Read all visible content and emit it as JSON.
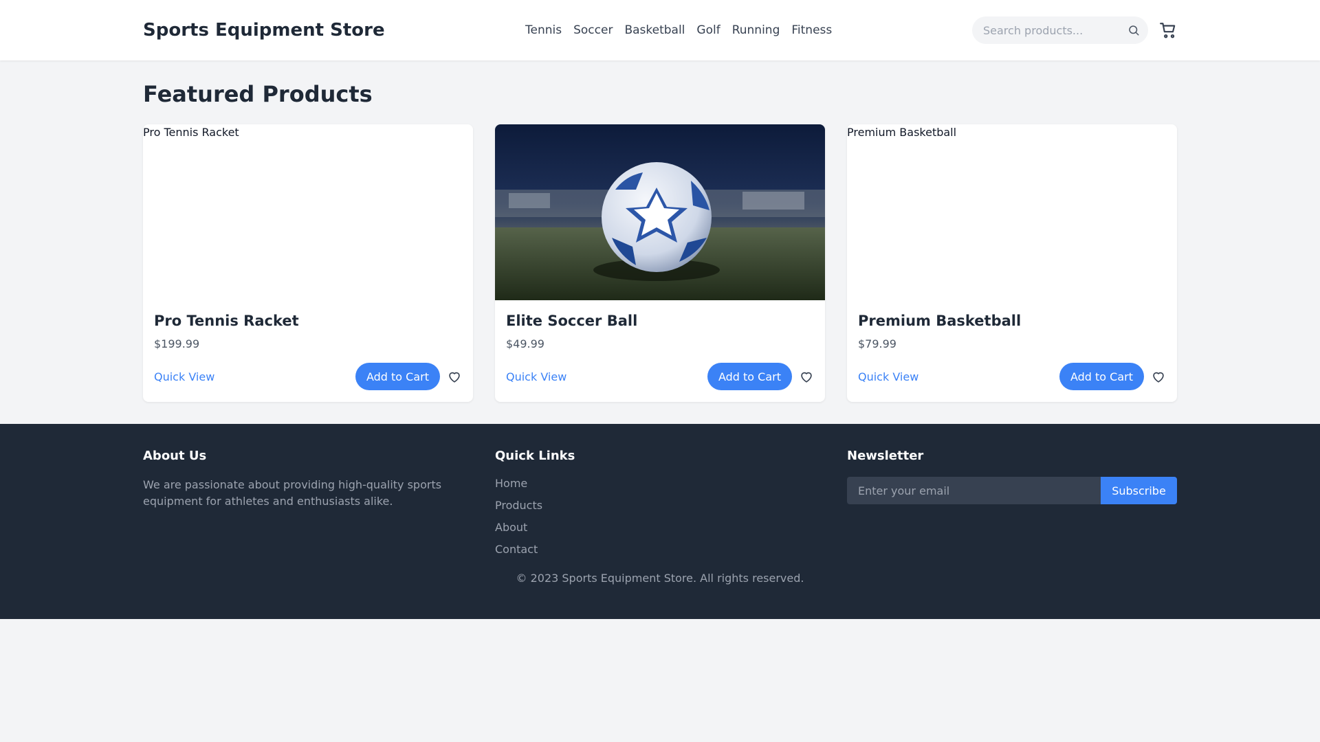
{
  "header": {
    "brand": "Sports Equipment Store",
    "nav": [
      "Tennis",
      "Soccer",
      "Basketball",
      "Golf",
      "Running",
      "Fitness"
    ],
    "search_placeholder": "Search products...",
    "search_icon": "search-icon",
    "cart_icon": "cart-icon"
  },
  "main": {
    "title": "Featured Products",
    "products": [
      {
        "name": "Pro Tennis Racket",
        "price": "$199.99",
        "image_alt": "Pro Tennis Racket",
        "image_loaded": false,
        "quick_view": "Quick View",
        "add_to_cart": "Add to Cart",
        "wishlist_icon": "heart-icon"
      },
      {
        "name": "Elite Soccer Ball",
        "price": "$49.99",
        "image_alt": "Elite Soccer Ball",
        "image_loaded": true,
        "quick_view": "Quick View",
        "add_to_cart": "Add to Cart",
        "wishlist_icon": "heart-icon"
      },
      {
        "name": "Premium Basketball",
        "price": "$79.99",
        "image_alt": "Premium Basketball",
        "image_loaded": false,
        "quick_view": "Quick View",
        "add_to_cart": "Add to Cart",
        "wishlist_icon": "heart-icon"
      }
    ]
  },
  "footer": {
    "about": {
      "heading": "About Us",
      "text": "We are passionate about providing high-quality sports equipment for athletes and enthusiasts alike."
    },
    "quick_links": {
      "heading": "Quick Links",
      "links": [
        "Home",
        "Products",
        "About",
        "Contact"
      ]
    },
    "newsletter": {
      "heading": "Newsletter",
      "placeholder": "Enter your email",
      "button": "Subscribe"
    },
    "copyright": "© 2023 Sports Equipment Store. All rights reserved."
  },
  "colors": {
    "accent": "#3b82f6",
    "page_bg": "#f3f4f6",
    "footer_bg": "#1f2937",
    "text_dark": "#1f2937",
    "text_muted": "#9ca3af"
  }
}
